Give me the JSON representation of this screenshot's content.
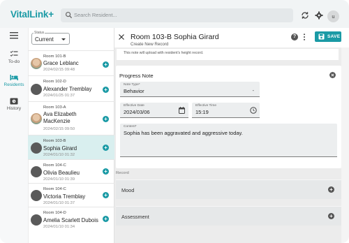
{
  "app": {
    "logo_text": "VitalLink+",
    "brand_color": "#1a9aa5"
  },
  "search": {
    "placeholder": "Search Resident..."
  },
  "user_avatar": "u",
  "rail": {
    "items": [
      {
        "label": "To-do",
        "icon": "checklist-icon"
      },
      {
        "label": "Residents",
        "icon": "bed-icon",
        "active": true
      },
      {
        "label": "History",
        "icon": "history-icon"
      }
    ]
  },
  "status": {
    "label": "Status",
    "value": "Current"
  },
  "residents": [
    {
      "room": "Room 101-B",
      "name": "Grace Leblanc",
      "date": "2024/02/15 09:48",
      "avatar": "photo"
    },
    {
      "room": "Room 102-D",
      "name": "Alexander  Tremblay",
      "date": "2024/01/25 01:37",
      "avatar": "person"
    },
    {
      "room": "Room 103-A",
      "name": "Ava Elizabeth MacKenzie",
      "date": "2024/02/15 09:50",
      "avatar": "photo"
    },
    {
      "room": "Room 103-B",
      "name": "Sophia Girard",
      "date": "2024/01/10 01:32",
      "avatar": "person",
      "selected": true
    },
    {
      "room": "Room 104-C",
      "name": "Olivia Beaulieu",
      "date": "2024/01/10 01:39",
      "avatar": "person"
    },
    {
      "room": "Room 104-C",
      "name": "Victoria Tremblay",
      "date": "2024/01/10 01:37",
      "avatar": "person"
    },
    {
      "room": "Room 104-D",
      "name": "Amelia Scarlett Dubois",
      "date": "2024/01/10 01:34",
      "avatar": "person"
    }
  ],
  "header": {
    "title": "Room 103-B Sophia Girard",
    "subtitle": "Create New Record",
    "save_label": "SAVE"
  },
  "note_top": "This note will upload with resident's height record.",
  "progress_note": {
    "title": "Progress Note",
    "note_type": {
      "label": "Note Type*",
      "value": "Behavior"
    },
    "effective_date": {
      "label": "Effective Date",
      "value": "2024/03/06"
    },
    "effective_time": {
      "label": "Effective Time",
      "value": "15:19"
    },
    "content": {
      "label": "Content*",
      "value": "Sophia has been aggravated and aggressive today."
    }
  },
  "record_section_label": "Record",
  "accordions": [
    {
      "label": "Mood"
    },
    {
      "label": "Assessment"
    }
  ]
}
